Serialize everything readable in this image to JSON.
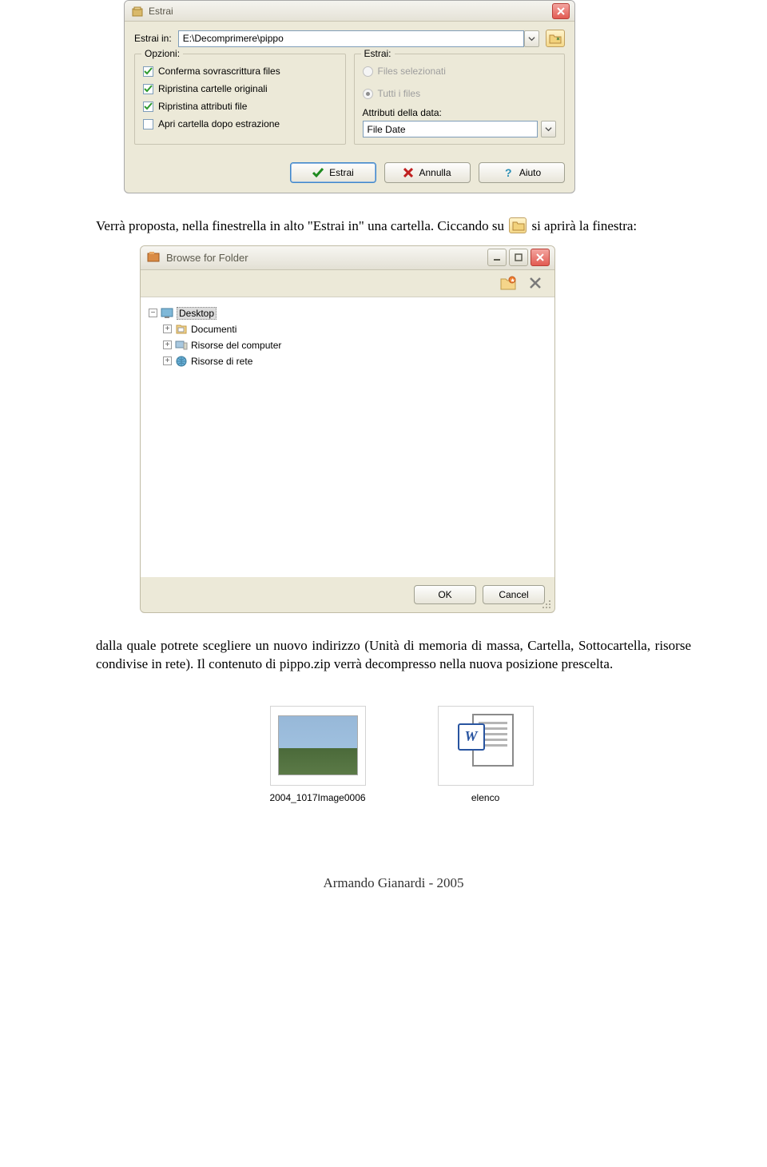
{
  "dialog1": {
    "title": "Estrai",
    "pathLabel": "Estrai in:",
    "pathValue": "E:\\Decomprimere\\pippo",
    "groupOptions": {
      "title": "Opzioni:",
      "items": [
        {
          "label": "Conferma sovrascrittura files",
          "checked": true
        },
        {
          "label": "Ripristina cartelle originali",
          "checked": true
        },
        {
          "label": "Ripristina attributi file",
          "checked": true
        },
        {
          "label": "Apri cartella dopo estrazione",
          "checked": false
        }
      ]
    },
    "groupExtract": {
      "title": "Estrai:",
      "items": [
        {
          "label": "Files selezionati",
          "selected": false,
          "enabled": false
        },
        {
          "label": "Tutti i files",
          "selected": true,
          "enabled": false
        }
      ]
    },
    "attrLabel": "Attributi della data:",
    "attrValue": "File Date",
    "buttons": {
      "estrai": "Estrai",
      "annulla": "Annulla",
      "aiuto": "Aiuto"
    }
  },
  "para1a": "Verrà proposta, nella finestrella in alto \"Estrai in\" una cartella. Ciccando su ",
  "para1b": " si aprirà la finestra:",
  "dialog2": {
    "title": "Browse for Folder",
    "tree": {
      "root": "Desktop",
      "items": [
        "Documenti",
        "Risorse del computer",
        "Risorse di rete"
      ]
    },
    "buttons": {
      "ok": "OK",
      "cancel": "Cancel"
    }
  },
  "para2": "dalla quale potrete scegliere un nuovo indirizzo (Unità di memoria di massa, Cartella, Sottocartella, risorse condivise in rete). Il contenuto di pippo.zip verrà decompresso nella nuova posizione prescelta.",
  "thumbs": {
    "t1": "2004_1017Image0006",
    "t2": "elenco"
  },
  "footer": "Armando Gianardi - 2005"
}
